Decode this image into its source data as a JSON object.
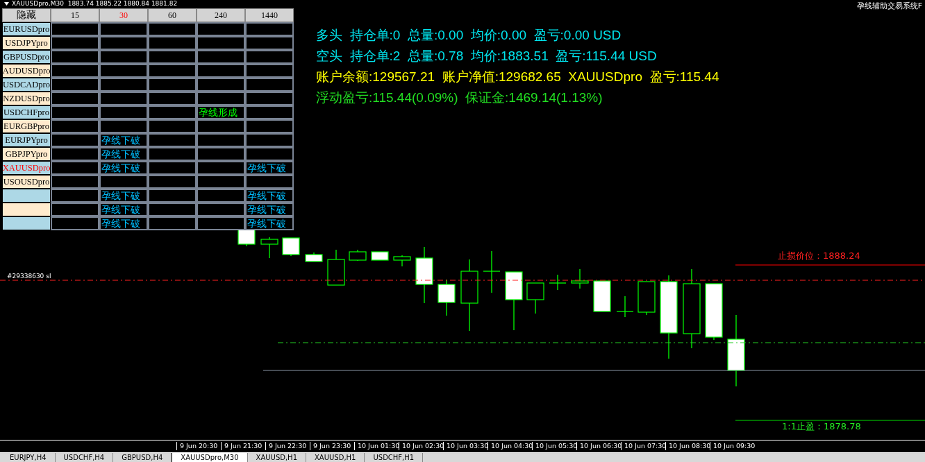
{
  "chart_title": "XAUUSDpro,M30  1883.74 1885.22 1880.84 1881.82",
  "system_title": "孕线辅助交易系统F",
  "signal_table": {
    "hide_button": "隐藏",
    "timeframes": [
      {
        "label": "15",
        "selected": false
      },
      {
        "label": "30",
        "selected": true
      },
      {
        "label": "60",
        "selected": false
      },
      {
        "label": "240",
        "selected": false
      },
      {
        "label": "1440",
        "selected": false
      }
    ],
    "rows": [
      {
        "symbol": "EURUSDpro",
        "selected": false,
        "cells": [
          {},
          {},
          {},
          {},
          {}
        ]
      },
      {
        "symbol": "USDJPYpro",
        "selected": false,
        "cells": [
          {},
          {},
          {},
          {},
          {}
        ]
      },
      {
        "symbol": "GBPUSDpro",
        "selected": false,
        "cells": [
          {},
          {},
          {},
          {},
          {}
        ]
      },
      {
        "symbol": "AUDUSDpro",
        "selected": false,
        "cells": [
          {},
          {},
          {},
          {},
          {}
        ]
      },
      {
        "symbol": "USDCADpro",
        "selected": false,
        "cells": [
          {},
          {},
          {},
          {},
          {}
        ]
      },
      {
        "symbol": "NZDUSDpro",
        "selected": false,
        "cells": [
          {},
          {},
          {},
          {},
          {}
        ]
      },
      {
        "symbol": "USDCHFpro",
        "selected": false,
        "cells": [
          {},
          {},
          {},
          {
            "text": "孕线形成",
            "kind": "formed"
          },
          {}
        ]
      },
      {
        "symbol": "EURGBPpro",
        "selected": false,
        "cells": [
          {},
          {},
          {},
          {},
          {}
        ]
      },
      {
        "symbol": "EURJPYpro",
        "selected": false,
        "cells": [
          {},
          {
            "text": "孕线下破",
            "kind": "breakdown"
          },
          {},
          {},
          {}
        ]
      },
      {
        "symbol": "GBPJPYpro",
        "selected": false,
        "cells": [
          {},
          {
            "text": "孕线下破",
            "kind": "breakdown"
          },
          {},
          {},
          {}
        ]
      },
      {
        "symbol": "XAUUSDpro",
        "selected": true,
        "cells": [
          {},
          {
            "text": "孕线下破",
            "kind": "breakdown"
          },
          {},
          {},
          {
            "text": "孕线下破",
            "kind": "breakdown"
          }
        ]
      },
      {
        "symbol": "USOUSDpro",
        "selected": false,
        "cells": [
          {},
          {},
          {},
          {},
          {}
        ]
      },
      {
        "cells": [
          {},
          {
            "text": "孕线下破",
            "kind": "breakdown"
          },
          {},
          {},
          {
            "text": "孕线下破",
            "kind": "breakdown"
          }
        ]
      },
      {
        "cells": [
          {},
          {
            "text": "孕线下破",
            "kind": "breakdown"
          },
          {},
          {},
          {
            "text": "孕线下破",
            "kind": "breakdown"
          }
        ]
      },
      {
        "cells": [
          {},
          {
            "text": "孕线下破",
            "kind": "breakdown"
          },
          {},
          {},
          {
            "text": "孕线下破",
            "kind": "breakdown"
          }
        ]
      }
    ]
  },
  "account_lines": [
    {
      "text": "多头  持仓单:0  总量:0.00  均价:0.00  盈亏:0.00 USD",
      "color": "#00e5ee"
    },
    {
      "text": "空头  持仓单:2  总量:0.78  均价:1883.51  盈亏:115.44 USD",
      "color": "#00e5ee"
    },
    {
      "text": "账户余额:129567.21  账户净值:129682.65  XAUUSDpro  盈亏:115.44",
      "color": "#ffff00"
    },
    {
      "text": "浮动盈亏:115.44(0.09%)  保证金:1469.14(1.13%)",
      "color": "#22dd22"
    }
  ],
  "order_label": "#29338630 sl",
  "stop_loss_label": "止损价位：1888.24",
  "take_profit_label": "1:1止盈：1878.78",
  "time_axis": [
    "9 Jun 20:30",
    "9 Jun 21:30",
    "9 Jun 22:30",
    "9 Jun 23:30",
    "10 Jun 01:30",
    "10 Jun 02:30",
    "10 Jun 03:30",
    "10 Jun 04:30",
    "10 Jun 05:30",
    "10 Jun 06:30",
    "10 Jun 07:30",
    "10 Jun 08:30",
    "10 Jun 09:30"
  ],
  "chart_tabs": [
    {
      "label": "EURJPY,H4",
      "selected": false
    },
    {
      "label": "USDCHF,H4",
      "selected": false
    },
    {
      "label": "GBPUSD,H4",
      "selected": false
    },
    {
      "label": "XAUUSDpro,M30",
      "selected": true
    },
    {
      "label": "XAUUSD,H1",
      "selected": false
    },
    {
      "label": "XAUUSD,H1",
      "selected": false
    },
    {
      "label": "USDCHF,H1",
      "selected": false
    }
  ]
}
